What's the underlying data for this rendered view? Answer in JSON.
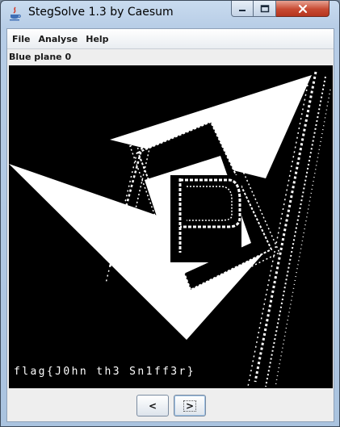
{
  "window": {
    "title": "StegSolve 1.3 by Caesum"
  },
  "menu": {
    "file": "File",
    "analyse": "Analyse",
    "help": "Help"
  },
  "plane_label": "Blue plane 0",
  "image": {
    "overlay_text": "flag{J0hn th3 Sn1ff3r}"
  },
  "nav": {
    "prev_label": "<",
    "next_label": ">"
  },
  "colors": {
    "window_frame": "#b7cde6",
    "close_button": "#c74a32",
    "image_background": "#000000",
    "image_foreground": "#ffffff"
  }
}
